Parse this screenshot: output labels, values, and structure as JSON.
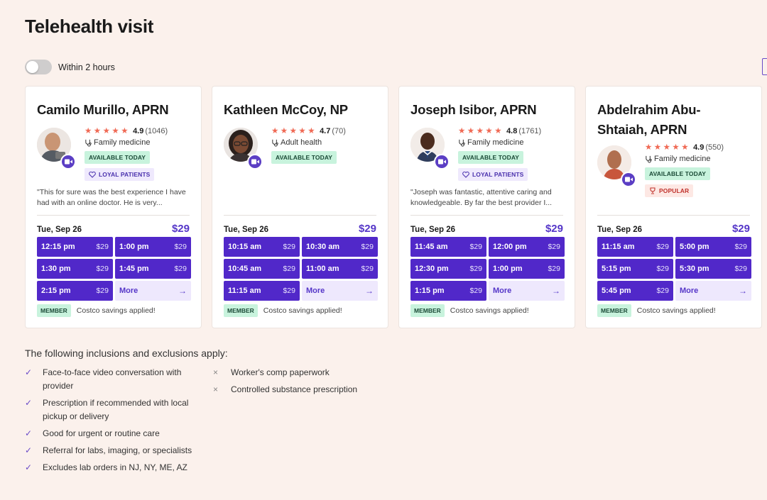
{
  "page": {
    "title": "Telehealth visit",
    "toggle_label": "Within 2 hours"
  },
  "colors": {
    "accent": "#5128c9",
    "background": "#fbf1ec",
    "available": "#c8f3dd",
    "star": "#f06a55"
  },
  "providers": [
    {
      "name": "Camilo Murillo, APRN",
      "stars": "★★★★★",
      "rating": "4.9",
      "review_count": "(1046)",
      "specialty": "Family medicine",
      "badges": {
        "available": "AVAILABLE TODAY",
        "loyal": "LOYAL PATIENTS"
      },
      "quote": "\"This for sure was the best experience I have had with an online doctor. He is very...",
      "date": "Tue, Sep 26",
      "price": "$29",
      "slots": [
        {
          "time": "12:15 pm",
          "price": "$29"
        },
        {
          "time": "1:00 pm",
          "price": "$29"
        },
        {
          "time": "1:30 pm",
          "price": "$29"
        },
        {
          "time": "1:45 pm",
          "price": "$29"
        },
        {
          "time": "2:15 pm",
          "price": "$29"
        }
      ],
      "more_label": "More",
      "member_badge": "MEMBER",
      "member_text": "Costco savings applied!"
    },
    {
      "name": "Kathleen McCoy, NP",
      "stars": "★★★★★",
      "rating": "4.7",
      "review_count": "(70)",
      "specialty": "Adult health",
      "badges": {
        "available": "AVAILABLE TODAY"
      },
      "quote": "",
      "date": "Tue, Sep 26",
      "price": "$29",
      "slots": [
        {
          "time": "10:15 am",
          "price": "$29"
        },
        {
          "time": "10:30 am",
          "price": "$29"
        },
        {
          "time": "10:45 am",
          "price": "$29"
        },
        {
          "time": "11:00 am",
          "price": "$29"
        },
        {
          "time": "11:15 am",
          "price": "$29"
        }
      ],
      "more_label": "More",
      "member_badge": "MEMBER",
      "member_text": "Costco savings applied!"
    },
    {
      "name": "Joseph Isibor, APRN",
      "stars": "★★★★★",
      "rating": "4.8",
      "review_count": "(1761)",
      "specialty": "Family medicine",
      "badges": {
        "available": "AVAILABLE TODAY",
        "loyal": "LOYAL PATIENTS"
      },
      "quote": "\"Joseph was fantastic, attentive caring and knowledgeable. By far the best provider I...",
      "date": "Tue, Sep 26",
      "price": "$29",
      "slots": [
        {
          "time": "11:45 am",
          "price": "$29"
        },
        {
          "time": "12:00 pm",
          "price": "$29"
        },
        {
          "time": "12:30 pm",
          "price": "$29"
        },
        {
          "time": "1:00 pm",
          "price": "$29"
        },
        {
          "time": "1:15 pm",
          "price": "$29"
        }
      ],
      "more_label": "More",
      "member_badge": "MEMBER",
      "member_text": "Costco savings applied!"
    },
    {
      "name": "Abdelrahim Abu-Shtaiah, APRN",
      "stars": "★★★★★",
      "rating": "4.9",
      "review_count": "(550)",
      "specialty": "Family medicine",
      "badges": {
        "available": "AVAILABLE TODAY",
        "popular": "POPULAR"
      },
      "quote": "",
      "date": "Tue, Sep 26",
      "price": "$29",
      "slots": [
        {
          "time": "11:15 am",
          "price": "$29"
        },
        {
          "time": "5:00 pm",
          "price": "$29"
        },
        {
          "time": "5:15 pm",
          "price": "$29"
        },
        {
          "time": "5:30 pm",
          "price": "$29"
        },
        {
          "time": "5:45 pm",
          "price": "$29"
        }
      ],
      "more_label": "More",
      "member_badge": "MEMBER",
      "member_text": "Costco savings applied!"
    }
  ],
  "inclusions": {
    "title": "The following inclusions and exclusions apply:",
    "included": [
      "Face-to-face video conversation with provider",
      "Prescription if recommended with local pickup or delivery",
      "Good for urgent or routine care",
      "Referral for labs, imaging, or specialists",
      "Excludes lab orders in NJ, NY, ME, AZ"
    ],
    "excluded": [
      "Worker's comp paperwork",
      "Controlled substance prescription"
    ],
    "check_mark": "✓",
    "cross_mark": "×"
  }
}
